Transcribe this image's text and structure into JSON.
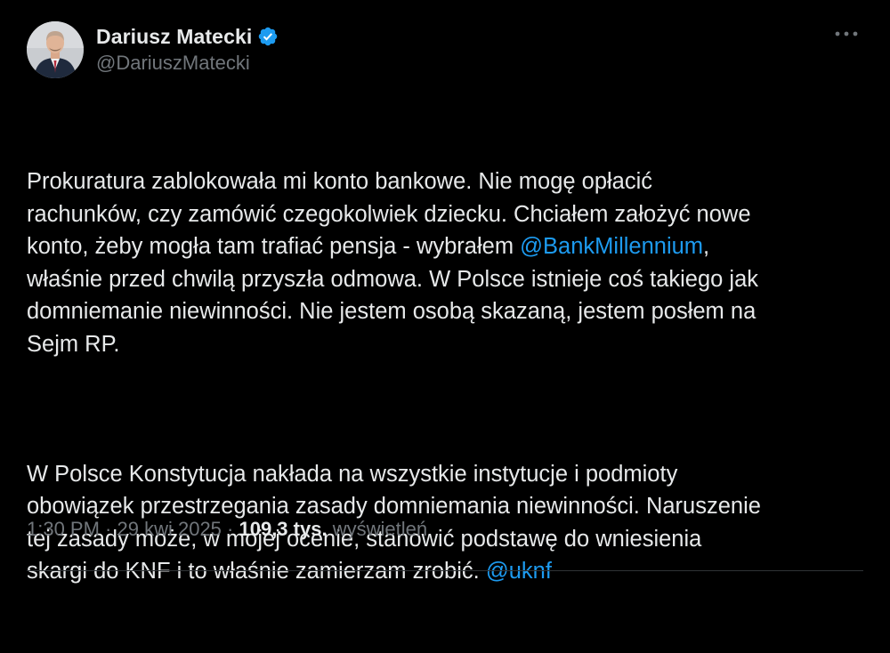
{
  "author": {
    "display_name": "Dariusz Matecki",
    "handle": "@DariuszMatecki",
    "verified": true
  },
  "icons": {
    "verified": "verified-badge-icon",
    "more": "more-options-icon"
  },
  "colors": {
    "background": "#000000",
    "text": "#e7e9ea",
    "secondary": "#71767b",
    "link": "#1d9bf0",
    "verified": "#1d9bf0"
  },
  "tweet": {
    "p1_line1": "Prokuratura zablokowała mi konto bankowe. Nie mogę opłacić",
    "p1_line2": "rachunków, czy zamówić czegokolwiek dziecku. Chciałem założyć nowe",
    "p1_line3_a": "konto, żeby mogła tam trafiać pensja - wybrałem ",
    "mention_bank": "@BankMillennium",
    "p1_line3_b": ",",
    "p1_line4": "właśnie przed chwilą przyszła odmowa. W Polsce istnieje coś takiego jak",
    "p1_line5": "domniemanie niewinności. Nie jestem osobą skazaną, jestem posłem na",
    "p1_line6": "Sejm RP.",
    "p2_line1": "W Polsce Konstytucja nakłada na wszystkie instytucje i podmioty",
    "p2_line2": "obowiązek przestrzegania zasady domniemania niewinności. Naruszenie",
    "p2_line3": "tej zasady może, w mojej ocenie, stanowić podstawę do wniesienia",
    "p2_line4_a": "skargi do KNF i to właśnie zamierzam zrobić. ",
    "mention_knf": "@uknf"
  },
  "meta": {
    "time": "1:30 PM",
    "separator": " · ",
    "date": "29 kwi 2025",
    "views_count": "109,3 tys.",
    "views_label": "wyświetleń"
  }
}
